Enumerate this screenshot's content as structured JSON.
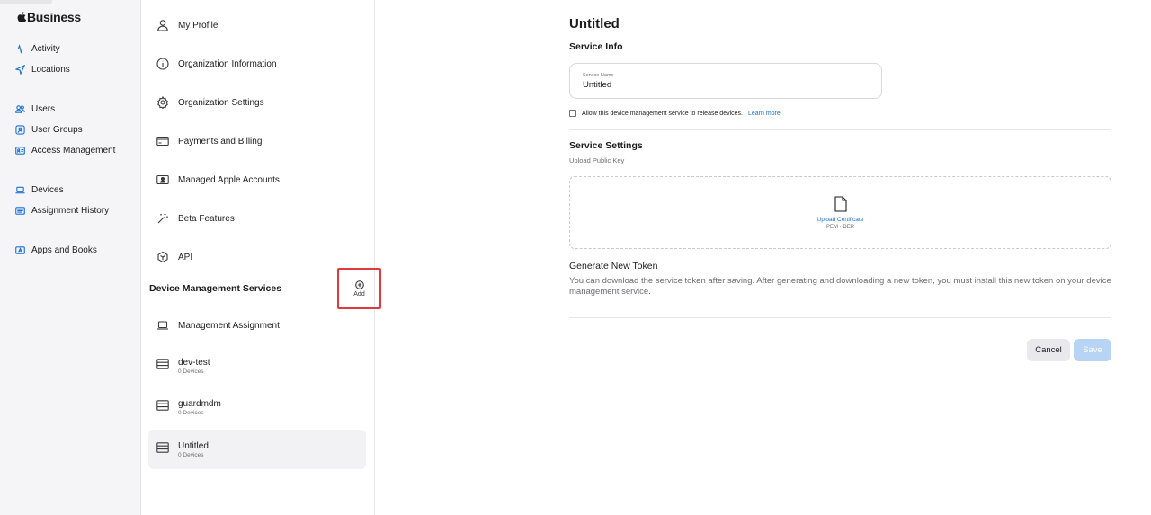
{
  "brand": {
    "name": "Business"
  },
  "nav": {
    "items": [
      {
        "label": "Activity",
        "icon": "activity-icon"
      },
      {
        "label": "Locations",
        "icon": "location-arrow-icon"
      },
      {
        "label": "Users",
        "icon": "users-icon"
      },
      {
        "label": "User Groups",
        "icon": "user-groups-icon"
      },
      {
        "label": "Access Management",
        "icon": "id-card-icon"
      },
      {
        "label": "Devices",
        "icon": "laptop-icon"
      },
      {
        "label": "Assignment History",
        "icon": "list-card-icon"
      },
      {
        "label": "Apps and Books",
        "icon": "apps-icon"
      }
    ]
  },
  "middle": {
    "items": [
      {
        "label": "My Profile",
        "icon": "person-icon"
      },
      {
        "label": "Organization Information",
        "icon": "info-icon"
      },
      {
        "label": "Organization Settings",
        "icon": "gear-icon"
      },
      {
        "label": "Payments and Billing",
        "icon": "credit-card-icon"
      },
      {
        "label": "Managed Apple Accounts",
        "icon": "account-card-icon"
      },
      {
        "label": "Beta Features",
        "icon": "magic-wand-icon"
      },
      {
        "label": "API",
        "icon": "api-icon"
      }
    ],
    "section_title": "Device Management Services",
    "add_label": "Add",
    "management_assignment": "Management Assignment",
    "services": [
      {
        "name": "dev-test",
        "count": "0 Devices"
      },
      {
        "name": "guardmdm",
        "count": "0 Devices"
      },
      {
        "name": "Untitled",
        "count": "0 Devices"
      }
    ]
  },
  "main": {
    "title": "Untitled",
    "service_info": "Service Info",
    "service_name_label": "Service Name",
    "service_name_value": "Untitled",
    "allow_release_text": "Allow this device management service to release devices.",
    "learn_more": "Learn more",
    "service_settings": "Service Settings",
    "upload_public_key": "Upload Public Key",
    "upload_certificate": "Upload Certificate",
    "cert_formats": "PEM · DER",
    "generate_token_title": "Generate New Token",
    "generate_token_desc": "You can download the service token after saving. After generating and downloading a new token, you must install this new token on your device management service.",
    "cancel": "Cancel",
    "save": "Save"
  },
  "colors": {
    "accent": "#1a6fd6",
    "highlight_border": "#e0393e",
    "save_disabled": "#b8d4f5"
  }
}
